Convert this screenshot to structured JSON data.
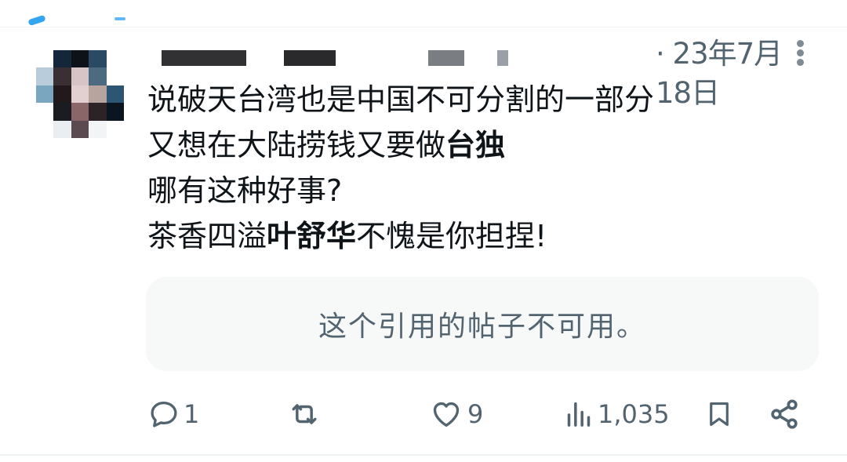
{
  "post": {
    "timestamp": "· 23年7月18日",
    "lines": [
      {
        "parts": [
          {
            "text": "说破天台湾也是中国不可分割的一部分",
            "bold": false
          }
        ]
      },
      {
        "parts": [
          {
            "text": "又想在大陆捞钱又要做",
            "bold": false
          },
          {
            "text": "台独",
            "bold": true
          }
        ]
      },
      {
        "parts": [
          {
            "text": "哪有这种好事?",
            "bold": false
          }
        ]
      },
      {
        "parts": [
          {
            "text": "茶香四溢",
            "bold": false
          },
          {
            "text": "叶舒华",
            "bold": true
          },
          {
            "text": "不愧是你担捏!",
            "bold": false
          }
        ]
      }
    ],
    "quote_unavailable": "这个引用的帖子不可用。"
  },
  "actions": {
    "reply": {
      "icon": "reply-icon",
      "count": "1"
    },
    "repost": {
      "icon": "repost-icon",
      "count": ""
    },
    "like": {
      "icon": "heart-icon",
      "count": "9"
    },
    "views": {
      "icon": "views-icon",
      "count": "1,035"
    },
    "bookmark": {
      "icon": "bookmark-icon"
    },
    "share": {
      "icon": "share-icon"
    }
  },
  "colors": {
    "text": "#0f1419",
    "secondary": "#536471",
    "quote_bg": "#f7f9f9",
    "accent": "#1d9bf0"
  }
}
